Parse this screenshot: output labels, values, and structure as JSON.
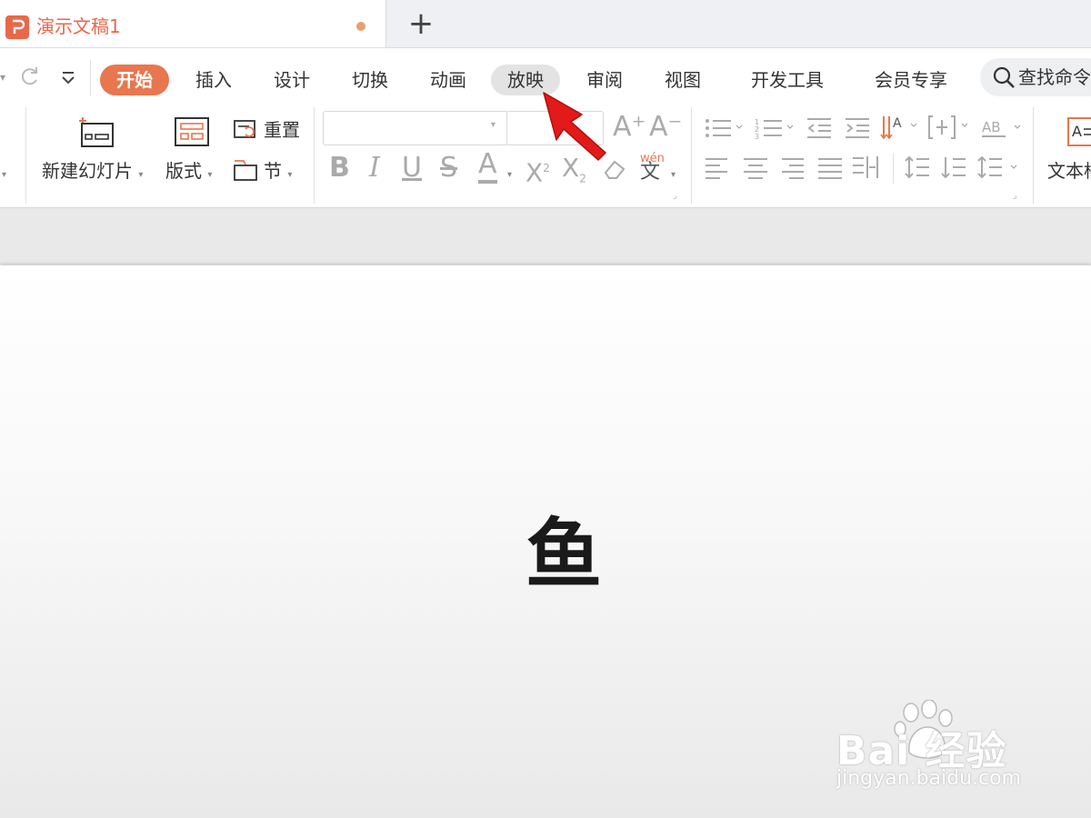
{
  "tab": {
    "title": "演示文稿1",
    "new_tab": "+"
  },
  "ribbon_tabs": [
    "开始",
    "插入",
    "设计",
    "切换",
    "动画",
    "放映",
    "审阅",
    "视图",
    "开发工具",
    "会员专享"
  ],
  "search": {
    "text": "查找命令"
  },
  "tools": {
    "new_slide": "新建幻灯片",
    "layout": "版式",
    "reset": "重置",
    "section": "节",
    "text_box": "文本框",
    "superscript": "2",
    "subscript": "2",
    "pinyin": "wén",
    "pinyin_char": "文",
    "grow_font": "A⁺",
    "shrink_font": "A⁻"
  },
  "slide": {
    "text": "鱼"
  },
  "watermark": {
    "logo": "Bai  经验",
    "url": "jingyan.baidu.com"
  },
  "colors": {
    "accent": "#e8764e",
    "pointer": "#e21a1a"
  }
}
